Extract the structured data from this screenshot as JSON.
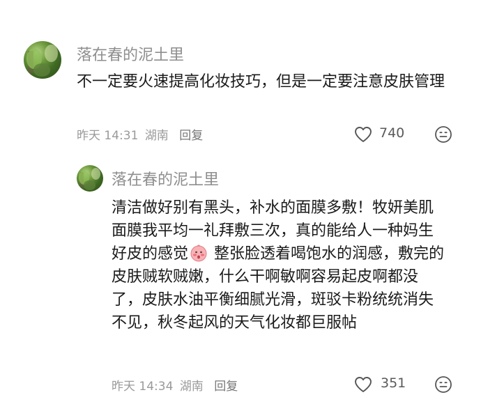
{
  "comments": [
    {
      "username": "落在春的泥土里",
      "text": "不一定要火速提高化妆技巧，但是一定要注意皮肤管理",
      "time": "昨天 14:31",
      "location": "湖南",
      "reply_label": "回复",
      "likes": "740"
    },
    {
      "username": "落在春的泥土里",
      "text_before_emoji": "清洁做好别有黑头，补水的面膜多敷！牧妍美肌面膜我平均一礼拜敷三次，真的能给人一种妈生好皮的感觉",
      "text_after_emoji": " 整张脸透着喝饱水的润感，敷完的皮肤贼软贼嫩，什么干啊敏啊容易起皮啊都没了，皮肤水油平衡细腻光滑，斑驳卡粉统统消失不见，秋冬起风的天气化妆都巨服帖",
      "time": "昨天 14:34",
      "location": "湖南",
      "reply_label": "回复",
      "likes": "351"
    }
  ],
  "icons": {
    "like": "heart-outline-icon",
    "react": "smiley-face-icon",
    "inline_emoji": "blushing-face-emoji"
  }
}
